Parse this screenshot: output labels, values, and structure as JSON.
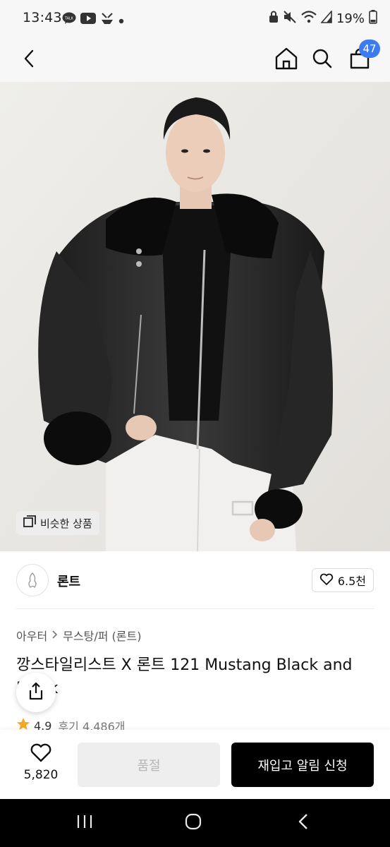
{
  "status_bar": {
    "time": "13:43",
    "left_icons": [
      "kakaotalk-icon",
      "youtube-icon",
      "notification-icon",
      "dot-icon"
    ],
    "right_icons": [
      "lock-icon",
      "mute-icon",
      "wifi-icon",
      "signal-icon",
      "battery-icon"
    ],
    "battery": "19%"
  },
  "header": {
    "back_icon": "back-arrow-icon",
    "home_icon": "home-icon",
    "search_icon": "search-icon",
    "cart_icon": "cart-icon",
    "cart_count": "47",
    "badge_color": "#3d7cf0"
  },
  "hero": {
    "similar_label": "비슷한 상품",
    "background_color": "#ebe9e6"
  },
  "brand": {
    "name": "론트",
    "like_count": "6.5천"
  },
  "product": {
    "breadcrumb": [
      "아우터",
      "무스탕/퍼 (론트)"
    ],
    "title": "깡스타일리스트 X 론트 121 Mustang Black and Black",
    "rating": "4.9",
    "reviews": "후기 4,486개",
    "star_color": "#f5a623"
  },
  "bottom_bar": {
    "wish_count": "5,820",
    "soldout_label": "품절",
    "restock_label": "재입고 알림 신청"
  },
  "nav_bar": {
    "recent_icon": "recent-apps-icon",
    "home_icon": "home-circle-icon",
    "back_icon": "back-chevron-icon"
  }
}
